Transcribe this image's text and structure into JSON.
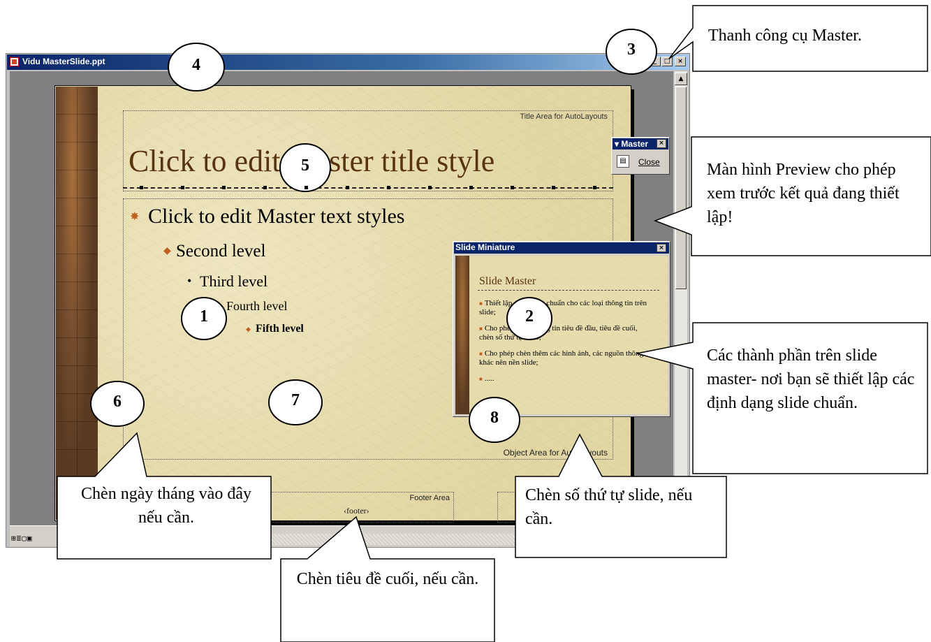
{
  "window": {
    "title": "Vidu MasterSlide.ppt",
    "buttons": {
      "minimize": "_",
      "maximize": "□",
      "close": "×"
    },
    "scroll_up": "▲",
    "view_icons": "⊞≣▢▣"
  },
  "slide": {
    "title_area_label": "Title Area for AutoLayouts",
    "master_title": "Click to edit Master title style",
    "levels": {
      "l1": "Click to edit Master text styles",
      "l2": "Second level",
      "l3": "Third level",
      "l4": "Fourth level",
      "l5": "Fifth level"
    },
    "bullets": {
      "l1": "✸",
      "l2": "◆",
      "l3": "•",
      "l4": "–",
      "l5": "◆"
    },
    "object_area_label": "Object Area for AutoLayouts",
    "footer_area_label": "Footer Area",
    "footer_tag": "‹footer›"
  },
  "master_toolbar": {
    "title": "▾ Master",
    "close_x": "×",
    "close_label": "Close"
  },
  "slide_miniature": {
    "title": "Slide Miniature",
    "close_x": "×",
    "heading": "Slide Master",
    "items": [
      "Thiết lập định dạng chuẩn cho các loại thông tin trên slide;",
      "Cho phép chèn thông tin tiêu đề đầu, tiêu đề cuối, chèn số thứ tự slide;",
      "Cho phép chèn thêm các hình ảnh, các nguồn thông tin khác nên nền slide;",
      "....."
    ]
  },
  "callouts": {
    "master_toolbar": "Thanh công cụ Master.",
    "preview": "Màn hình Preview cho phép xem trước kết quả đang thiết lập!",
    "components": "Các thành phần trên slide master- nơi bạn sẽ thiết lập các định dạng slide chuẩn.",
    "date": "Chèn ngày tháng vào đây nếu cần.",
    "footer": "Chèn tiêu đề cuối, nếu cần.",
    "slide_number": "Chèn số thứ tự slide, nếu cần."
  },
  "markers": [
    "1",
    "2",
    "3",
    "4",
    "5",
    "6",
    "7",
    "8"
  ]
}
